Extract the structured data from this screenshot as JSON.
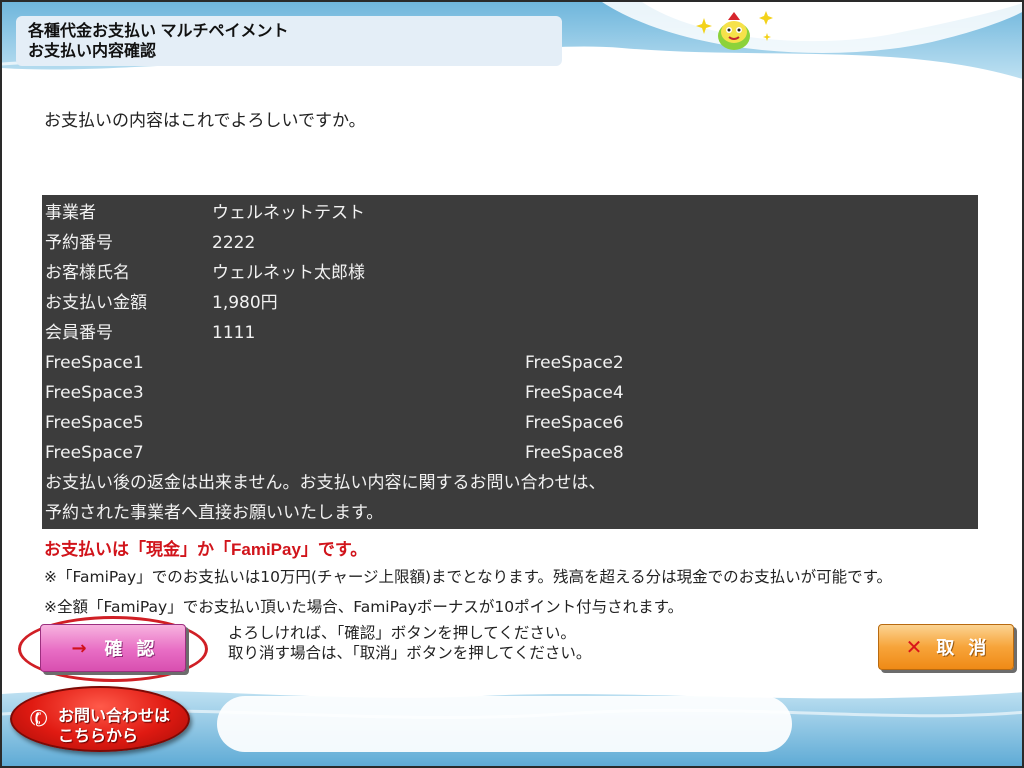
{
  "header": {
    "title_line1": "各種代金お支払い マルチペイメント",
    "title_line2": "お支払い内容確認"
  },
  "prompt": "お支払いの内容はこれでよろしいですか。",
  "details": {
    "rows": [
      {
        "label": "事業者",
        "value": "ウェルネットテスト"
      },
      {
        "label": "予約番号",
        "value": "2222"
      },
      {
        "label": "お客様氏名",
        "value": "ウェルネット太郎様"
      },
      {
        "label": "お支払い金額",
        "value": "1,980円"
      },
      {
        "label": "会員番号",
        "value": "1111"
      }
    ],
    "free_spaces": [
      {
        "left": "FreeSpace1",
        "right": "FreeSpace2"
      },
      {
        "left": "FreeSpace3",
        "right": "FreeSpace4"
      },
      {
        "left": "FreeSpace5",
        "right": "FreeSpace6"
      },
      {
        "left": "FreeSpace7",
        "right": "FreeSpace8"
      }
    ],
    "note_line1": "お支払い後の返金は出来ません。お支払い内容に関するお問い合わせは、",
    "note_line2": "予約された事業者へ直接お願いいたします。"
  },
  "notices": {
    "payment_methods": "お支払いは「現金」か「FamiPay」です。",
    "limit_note": "※「FamiPay」でのお支払いは10万円(チャージ上限額)までとなります。残高を超える分は現金でのお支払いが可能です。",
    "bonus_note": "※全額「FamiPay」でお支払い頂いた場合、FamiPayボーナスが10ポイント付与されます。"
  },
  "actions": {
    "confirm_label": "確認",
    "confirm_arrow": "→",
    "cancel_label": "取消",
    "cancel_mark": "✕",
    "instruction_line1": "よろしければ、「確認」ボタンを押してください。",
    "instruction_line2": "取り消す場合は、「取消」ボタンを押してください。"
  },
  "footer": {
    "inquiry_line1": "お問い合わせは",
    "inquiry_line2": "こちらから",
    "inquiry_icon": "phone-icon"
  },
  "colors": {
    "panel_bg": "#3c3c3c",
    "notice_red": "#d1141b",
    "confirm_button": "#e86dc4",
    "cancel_button": "#f7a43a",
    "inquiry_button": "#e01a12",
    "highlight_circle": "#d01f25"
  }
}
